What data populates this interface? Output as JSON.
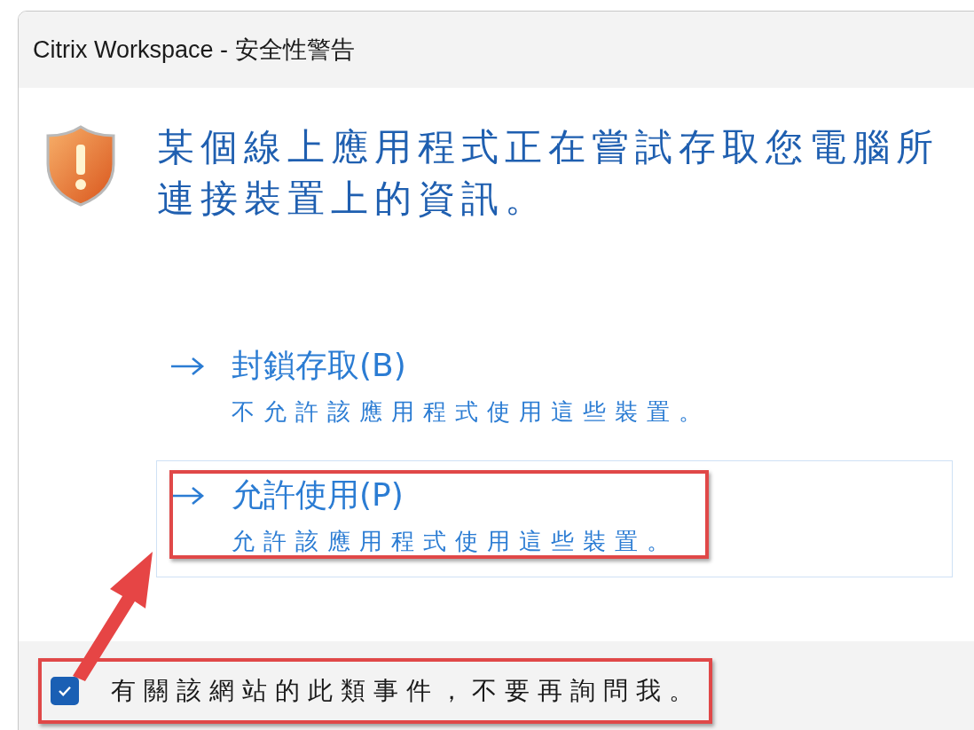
{
  "window": {
    "title": "Citrix Workspace - 安全性警告"
  },
  "message": "某個線上應用程式正在嘗試存取您電腦所連接裝置上的資訊。",
  "options": [
    {
      "label": "封鎖存取(B)",
      "description": "不允許該應用程式使用這些裝置。",
      "selected": false,
      "highlighted": false
    },
    {
      "label": "允許使用(P)",
      "description": "允許該應用程式使用這些裝置。",
      "selected": true,
      "highlighted": true
    }
  ],
  "dont_ask": {
    "label": "有關該網站的此類事件，不要再詢問我。",
    "checked": true,
    "highlighted": true
  }
}
